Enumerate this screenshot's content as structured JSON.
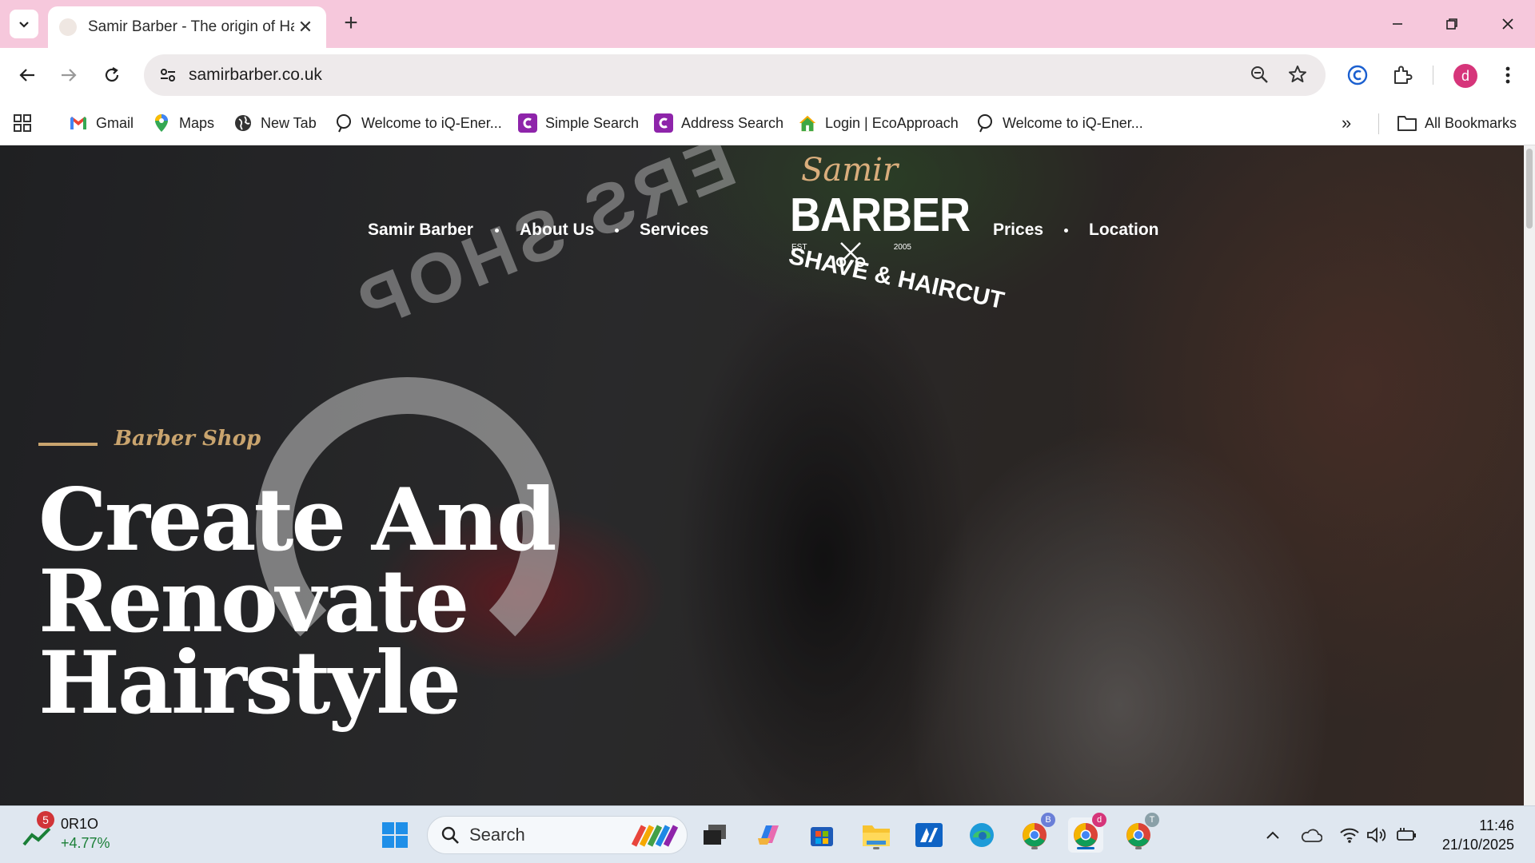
{
  "browser": {
    "tab_title": "Samir Barber - The origin of Hai",
    "url": "samirbarber.co.uk",
    "profile_initial": "d",
    "bookmarks": [
      {
        "label": "Gmail"
      },
      {
        "label": "Maps"
      },
      {
        "label": "New Tab"
      },
      {
        "label": "Welcome to iQ-Ener..."
      },
      {
        "label": "Simple Search"
      },
      {
        "label": "Address Search"
      },
      {
        "label": "Login | EcoApproach"
      },
      {
        "label": "Welcome to iQ-Ener..."
      }
    ],
    "all_bookmarks": "All Bookmarks",
    "overflow": "»"
  },
  "site": {
    "nav": {
      "home": "Samir Barber",
      "about": "About Us",
      "services": "Services",
      "prices": "Prices",
      "location": "Location"
    },
    "logo": {
      "script": "Samir",
      "wordmark": "BARBER",
      "est": "EST",
      "year": "2005",
      "tagline": "SHAVE & HAIRCUT"
    },
    "eyebrow": "Barber Shop",
    "headline": "Create And Renovate Hairstyle"
  },
  "taskbar": {
    "stock_name": "0R1O",
    "stock_change": "+4.77%",
    "notification_count": "5",
    "search_label": "Search",
    "time": "11:46",
    "date": "21/10/2025",
    "chrome_profile_badges": [
      "B",
      "d",
      "T"
    ]
  },
  "colors": {
    "tab_strip": "#f6c8dc",
    "accent_gold": "#c9a46e",
    "profile": "#d6357a"
  }
}
